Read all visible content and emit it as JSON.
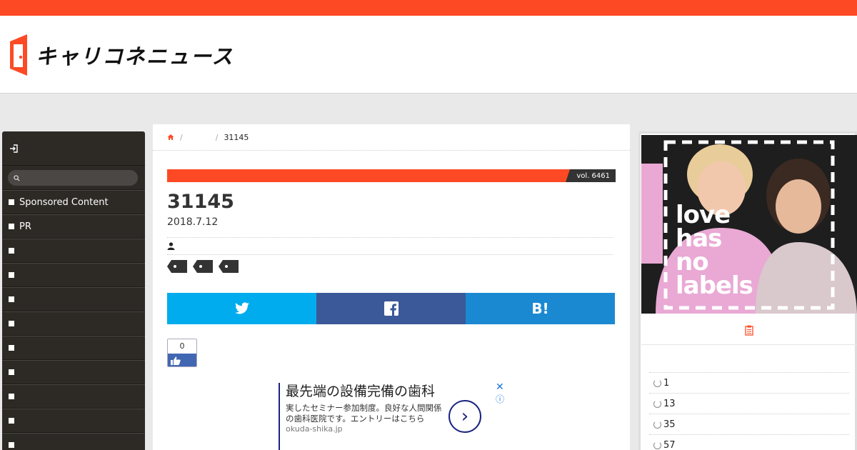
{
  "brand": {
    "name": "キャリコネニュース",
    "accent": "#fd4a25"
  },
  "sidebar": {
    "login_icon": "sign-in-icon",
    "search_placeholder": "",
    "items": [
      {
        "label": "Sponsored Content"
      },
      {
        "label": "PR"
      },
      {
        "label": ""
      },
      {
        "label": ""
      },
      {
        "label": ""
      },
      {
        "label": ""
      },
      {
        "label": ""
      },
      {
        "label": ""
      },
      {
        "label": ""
      },
      {
        "label": ""
      },
      {
        "label": ""
      }
    ]
  },
  "breadcrumb": {
    "home_icon": "home-icon",
    "category": "",
    "current": "31145"
  },
  "article": {
    "vol": "vol. 6461",
    "title": "31145",
    "date": "2018.7.12",
    "author_icon": "user-icon"
  },
  "share": {
    "twitter_color": "#00aced",
    "facebook_color": "#3b5998",
    "hatena_color": "#1b89d2",
    "hatena_label": "B!"
  },
  "like": {
    "count": "0"
  },
  "ad": {
    "title": "最先端の設備完備の歯科",
    "description": "実したセミナー参加制度。良好な人間関係の歯科医院です。エントリーはこちら",
    "url": "okuda-shika.jp",
    "close": "✕",
    "info": "ⓘ"
  },
  "right_ad": {
    "text_lines": [
      "love",
      "has",
      "no",
      "labels"
    ]
  },
  "ranking": {
    "head_icon": "clipboard-icon",
    "items": [
      {
        "label": "1"
      },
      {
        "label": "13"
      },
      {
        "label": "35"
      },
      {
        "label": "57"
      }
    ]
  }
}
